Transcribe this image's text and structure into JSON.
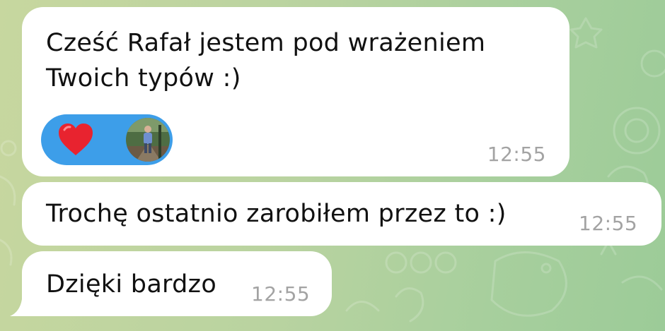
{
  "colors": {
    "bubble": "#ffffff",
    "text": "#111111",
    "time": "#a3a3a3",
    "reaction_pill": "#3d9ee9",
    "heart": "#e8232f",
    "background": "#b9d3a0"
  },
  "messages": [
    {
      "text_lines": [
        "Cześć Rafał jestem pod wrażeniem",
        "Twoich typów :)"
      ],
      "time": "12:55",
      "reaction": {
        "icon": "heart-icon",
        "reactor": "avatar"
      }
    },
    {
      "text": "Trochę ostatnio zarobiłem przez to :)",
      "time": "12:55"
    },
    {
      "text": "Dzięki bardzo",
      "time": "12:55"
    }
  ]
}
